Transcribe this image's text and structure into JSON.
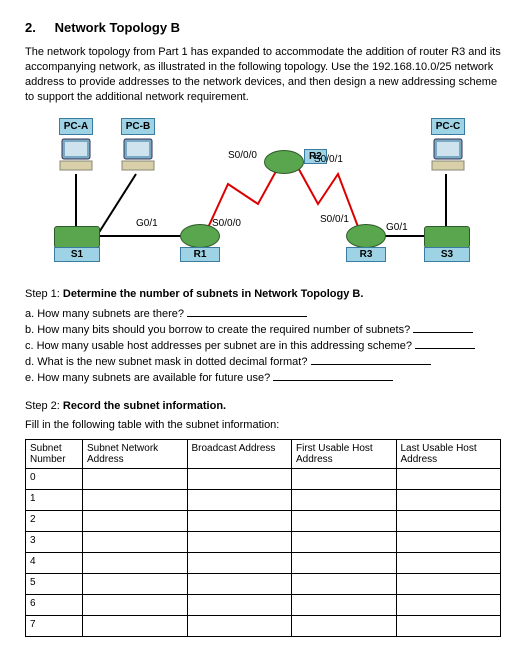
{
  "heading_num": "2.",
  "heading_title": "Network Topology B",
  "intro": "The network topology from Part 1 has expanded to accommodate the addition of router R3 and its accompanying network, as illustrated in the following topology. Use the 192.168.10.0/25 network address to provide addresses to the network devices, and then design a new addressing scheme to support the additional network requirement.",
  "diagram": {
    "pc_a": "PC-A",
    "pc_b": "PC-B",
    "pc_c": "PC-C",
    "r1": "R1",
    "r2": "R2",
    "r3": "R3",
    "s1": "S1",
    "s3": "S3",
    "if": {
      "r1_g01": "G0/1",
      "r1_s000": "S0/0/0",
      "r2_s000": "S0/0/0",
      "r2_s001": "S0/0/1",
      "r3_s001": "S0/0/1",
      "r3_g01": "G0/1"
    }
  },
  "step1": {
    "title_prefix": "Step 1: ",
    "title_bold": "Determine the number of subnets in Network Topology B.",
    "a": "a. How many subnets are there?",
    "b": "b. How many bits should you borrow to create the required number of subnets?",
    "c": "c. How many usable host addresses per subnet are in this addressing scheme?",
    "d": "d. What is the new subnet mask in dotted decimal format?",
    "e": "e. How many subnets are available for future use?"
  },
  "step2": {
    "title_prefix": "Step 2: ",
    "title_bold": "Record the subnet information.",
    "instr": "Fill in the following table with the subnet information:"
  },
  "table": {
    "headers": [
      "Subnet Number",
      "Subnet Network Address",
      "Broadcast Address",
      "First Usable Host Address",
      "Last Usable Host Address"
    ],
    "rows": [
      "0",
      "1",
      "2",
      "3",
      "4",
      "5",
      "6",
      "7"
    ]
  }
}
